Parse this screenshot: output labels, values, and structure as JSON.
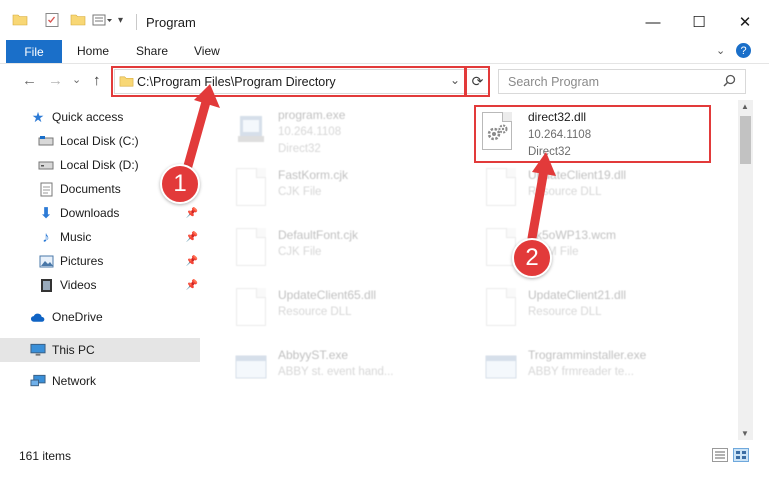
{
  "window": {
    "title": "Program",
    "minimize": "—",
    "maximize": "☐",
    "close": "✕"
  },
  "ribbon": {
    "tabs": [
      {
        "label": "File"
      },
      {
        "label": "Home"
      },
      {
        "label": "Share"
      },
      {
        "label": "View"
      }
    ],
    "help": "?"
  },
  "navigation": {
    "back": "←",
    "forward": "→",
    "recent": "⌄",
    "up": "↑"
  },
  "address": {
    "path": "C:\\Program Files\\Program Directory",
    "dropdown": "⌄",
    "refresh": "⟳"
  },
  "search": {
    "placeholder": "Search Program",
    "icon": "🔍"
  },
  "sidebar": {
    "items": [
      {
        "label": "Quick access",
        "icon": "star-icon"
      },
      {
        "label": "Local Disk (C:)",
        "icon": "drive-icon"
      },
      {
        "label": "Local Disk (D:)",
        "icon": "drive-icon"
      },
      {
        "label": "Documents",
        "icon": "document-icon"
      },
      {
        "label": "Downloads",
        "icon": "download-icon"
      },
      {
        "label": "Music",
        "icon": "music-icon"
      },
      {
        "label": "Pictures",
        "icon": "picture-icon"
      },
      {
        "label": "Videos",
        "icon": "video-icon"
      },
      {
        "label": "OneDrive",
        "icon": "cloud-icon"
      },
      {
        "label": "This PC",
        "icon": "computer-icon"
      },
      {
        "label": "Network",
        "icon": "network-icon"
      }
    ]
  },
  "files": [
    {
      "name": "program.exe",
      "line1": "10.264.1108",
      "line2": "Direct32",
      "icon": "exe-icon"
    },
    {
      "name": "direct32.dll",
      "line1": "10.264.1108",
      "line2": "Direct32",
      "icon": "dll-gear-icon"
    },
    {
      "name": "FastKorm.cjk",
      "line1": "CJK File",
      "line2": "",
      "icon": "blank-file-icon"
    },
    {
      "name": "UpdateClient19.dll",
      "line1": "Resource DLL",
      "line2": "",
      "icon": "dll-gear-icon"
    },
    {
      "name": "DefaultFont.cjk",
      "line1": "CJK File",
      "line2": "",
      "icon": "blank-file-icon"
    },
    {
      "name": "Sk5oWP13.wcm",
      "line1": "WCM File",
      "line2": "",
      "icon": "blank-file-icon"
    },
    {
      "name": "UpdateClient65.dll",
      "line1": "Resource DLL",
      "line2": "",
      "icon": "dll-gear-icon"
    },
    {
      "name": "UpdateClient21.dll",
      "line1": "Resource DLL",
      "line2": "",
      "icon": "dll-gear-icon"
    },
    {
      "name": "AbbyyST.exe",
      "line1": "ABBY st. event hand...",
      "line2": "",
      "icon": "exe-icon"
    },
    {
      "name": "Trogramminstaller.exe",
      "line1": "ABBY frmreader te...",
      "line2": "",
      "icon": "exe-icon"
    }
  ],
  "annotations": {
    "badge1": "1",
    "badge2": "2",
    "color": "#e23a3a"
  },
  "status": {
    "item_count": "161 items"
  },
  "colors": {
    "accent": "#1a6fc9",
    "highlight": "#e23a3a",
    "selected": "#e5e5e5"
  }
}
